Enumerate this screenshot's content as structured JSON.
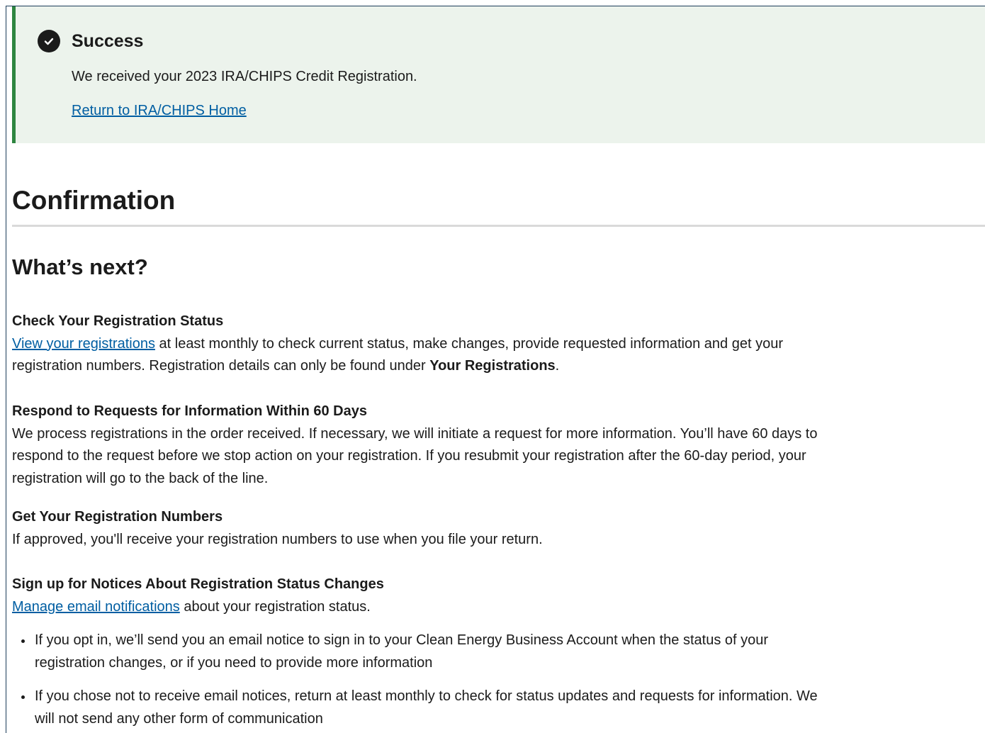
{
  "alert": {
    "icon": "check-circle-icon",
    "title": "Success",
    "message": "We received your 2023 IRA/CHIPS Credit Registration.",
    "link_label": "Return to IRA/CHIPS Home",
    "background_color": "#ecf3ec",
    "accent_color": "#2e8540"
  },
  "page": {
    "title": "Confirmation",
    "section_title": "What’s next?"
  },
  "sections": [
    {
      "heading": "Check Your Registration Status",
      "link_label": "View your registrations",
      "text_after_link": " at least monthly to check current status, make changes, provide requested information and get your registration numbers. Registration details can only be found under ",
      "bold_text": "Your Registrations",
      "text_end": "."
    },
    {
      "heading": "Respond to Requests for Information Within 60 Days",
      "text": "We process registrations in the order received. If necessary, we will initiate a request for more information.  You’ll have 60 days to respond to the request before we stop action on your registration. If you resubmit your registration after the 60-day period, your registration will go to the back of the line."
    },
    {
      "heading": "Get Your Registration Numbers",
      "text": "If approved, you'll receive your registration numbers to use when you file your return."
    },
    {
      "heading": "Sign up for Notices About Registration Status Changes",
      "link_label": "Manage email notifications",
      "text_after_link": " about your registration status."
    }
  ],
  "bullets": [
    "If you opt in, we’ll send you an email notice to sign in to your Clean Energy Business Account when the status of your registration changes, or if you need to provide more information",
    "If you chose not to receive email notices, return at least monthly to check for status updates and requests for information. We will not send any other form of communication"
  ],
  "colors": {
    "link": "#005ea2",
    "text": "#1b1b1b"
  }
}
